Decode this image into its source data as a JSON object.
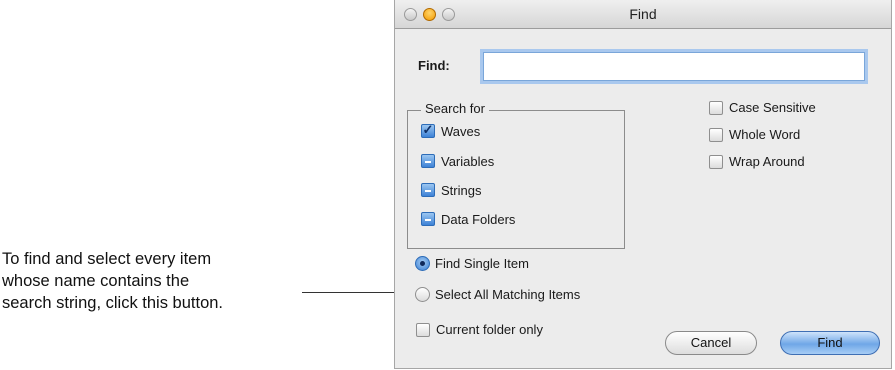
{
  "annotation": {
    "lines": [
      "To find and select every item",
      "whose name contains the",
      "search string, click this button."
    ]
  },
  "window": {
    "title": "Find"
  },
  "find": {
    "label": "Find:",
    "value": ""
  },
  "search_for": {
    "title": "Search for",
    "items": [
      {
        "label": "Waves",
        "state": "checked"
      },
      {
        "label": "Variables",
        "state": "mixed"
      },
      {
        "label": "Strings",
        "state": "mixed"
      },
      {
        "label": "Data Folders",
        "state": "mixed"
      }
    ]
  },
  "options": [
    {
      "label": "Case Sensitive",
      "checked": false
    },
    {
      "label": "Whole Word",
      "checked": false
    },
    {
      "label": "Wrap Around",
      "checked": false
    }
  ],
  "mode": [
    {
      "label": "Find Single Item",
      "selected": true
    },
    {
      "label": "Select All Matching Items",
      "selected": false
    }
  ],
  "current_folder_only": {
    "label": "Current folder only",
    "checked": false
  },
  "buttons": {
    "cancel": "Cancel",
    "find": "Find"
  },
  "colors": {
    "accent": "#3d82d6",
    "window_bg": "#ececec",
    "focus_ring": "#a9c8ee"
  },
  "icons": {
    "checked": "checkmark-icon",
    "mixed": "dash-icon"
  }
}
